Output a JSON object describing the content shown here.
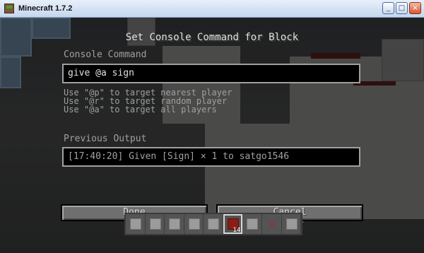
{
  "window": {
    "title": "Minecraft 1.7.2",
    "min_label": "_",
    "max_label": "□",
    "close_label": "×"
  },
  "dialog": {
    "title": "Set Console Command for Block",
    "console_label": "Console Command",
    "command_value": "give @a sign",
    "hints": [
      "Use \"@p\" to target nearest player",
      "Use \"@r\" to target random player",
      "Use \"@a\" to target all players"
    ],
    "previous_output_label": "Previous Output",
    "previous_output_value": "[17:40:20] Given [Sign] × 1 to satgo1546",
    "done_label": "Done",
    "cancel_label": "Cancel"
  },
  "hotbar": {
    "selected_count": "14"
  },
  "colors": {
    "text": "#e0e0e0",
    "label": "#a0a0a0",
    "field_bg": "#000000",
    "button_bg": "#6f6f6f"
  }
}
